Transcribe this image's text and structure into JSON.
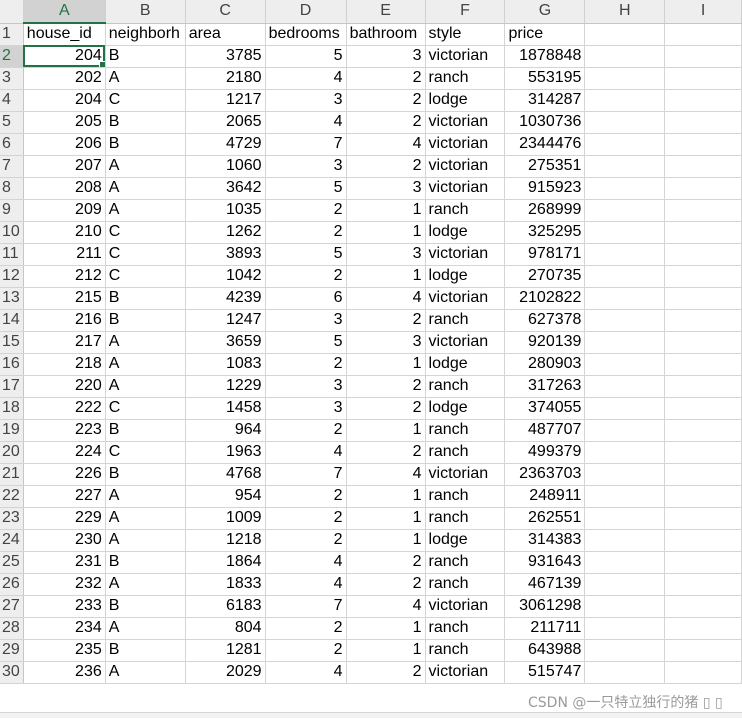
{
  "columns": [
    "A",
    "B",
    "C",
    "D",
    "E",
    "F",
    "G",
    "H",
    "I"
  ],
  "headers": [
    "house_id",
    "neighborh",
    "area",
    "bedrooms",
    "bathroom",
    "style",
    "price",
    "",
    ""
  ],
  "header_row_number": "1",
  "rows": [
    {
      "n": "2",
      "cells": [
        "204",
        "B",
        "3785",
        "5",
        "3",
        "victorian",
        "1878848"
      ]
    },
    {
      "n": "3",
      "cells": [
        "202",
        "A",
        "2180",
        "4",
        "2",
        "ranch",
        "553195"
      ]
    },
    {
      "n": "4",
      "cells": [
        "204",
        "C",
        "1217",
        "3",
        "2",
        "lodge",
        "314287"
      ]
    },
    {
      "n": "5",
      "cells": [
        "205",
        "B",
        "2065",
        "4",
        "2",
        "victorian",
        "1030736"
      ]
    },
    {
      "n": "6",
      "cells": [
        "206",
        "B",
        "4729",
        "7",
        "4",
        "victorian",
        "2344476"
      ]
    },
    {
      "n": "7",
      "cells": [
        "207",
        "A",
        "1060",
        "3",
        "2",
        "victorian",
        "275351"
      ]
    },
    {
      "n": "8",
      "cells": [
        "208",
        "A",
        "3642",
        "5",
        "3",
        "victorian",
        "915923"
      ]
    },
    {
      "n": "9",
      "cells": [
        "209",
        "A",
        "1035",
        "2",
        "1",
        "ranch",
        "268999"
      ]
    },
    {
      "n": "10",
      "cells": [
        "210",
        "C",
        "1262",
        "2",
        "1",
        "lodge",
        "325295"
      ]
    },
    {
      "n": "11",
      "cells": [
        "211",
        "C",
        "3893",
        "5",
        "3",
        "victorian",
        "978171"
      ]
    },
    {
      "n": "12",
      "cells": [
        "212",
        "C",
        "1042",
        "2",
        "1",
        "lodge",
        "270735"
      ]
    },
    {
      "n": "13",
      "cells": [
        "215",
        "B",
        "4239",
        "6",
        "4",
        "victorian",
        "2102822"
      ]
    },
    {
      "n": "14",
      "cells": [
        "216",
        "B",
        "1247",
        "3",
        "2",
        "ranch",
        "627378"
      ]
    },
    {
      "n": "15",
      "cells": [
        "217",
        "A",
        "3659",
        "5",
        "3",
        "victorian",
        "920139"
      ]
    },
    {
      "n": "16",
      "cells": [
        "218",
        "A",
        "1083",
        "2",
        "1",
        "lodge",
        "280903"
      ]
    },
    {
      "n": "17",
      "cells": [
        "220",
        "A",
        "1229",
        "3",
        "2",
        "ranch",
        "317263"
      ]
    },
    {
      "n": "18",
      "cells": [
        "222",
        "C",
        "1458",
        "3",
        "2",
        "lodge",
        "374055"
      ]
    },
    {
      "n": "19",
      "cells": [
        "223",
        "B",
        "964",
        "2",
        "1",
        "ranch",
        "487707"
      ]
    },
    {
      "n": "20",
      "cells": [
        "224",
        "C",
        "1963",
        "4",
        "2",
        "ranch",
        "499379"
      ]
    },
    {
      "n": "21",
      "cells": [
        "226",
        "B",
        "4768",
        "7",
        "4",
        "victorian",
        "2363703"
      ]
    },
    {
      "n": "22",
      "cells": [
        "227",
        "A",
        "954",
        "2",
        "1",
        "ranch",
        "248911"
      ]
    },
    {
      "n": "23",
      "cells": [
        "229",
        "A",
        "1009",
        "2",
        "1",
        "ranch",
        "262551"
      ]
    },
    {
      "n": "24",
      "cells": [
        "230",
        "A",
        "1218",
        "2",
        "1",
        "lodge",
        "314383"
      ]
    },
    {
      "n": "25",
      "cells": [
        "231",
        "B",
        "1864",
        "4",
        "2",
        "ranch",
        "931643"
      ]
    },
    {
      "n": "26",
      "cells": [
        "232",
        "A",
        "1833",
        "4",
        "2",
        "ranch",
        "467139"
      ]
    },
    {
      "n": "27",
      "cells": [
        "233",
        "B",
        "6183",
        "7",
        "4",
        "victorian",
        "3061298"
      ]
    },
    {
      "n": "28",
      "cells": [
        "234",
        "A",
        "804",
        "2",
        "1",
        "ranch",
        "211711"
      ]
    },
    {
      "n": "29",
      "cells": [
        "235",
        "B",
        "1281",
        "2",
        "1",
        "ranch",
        "643988"
      ]
    },
    {
      "n": "30",
      "cells": [
        "236",
        "A",
        "2029",
        "4",
        "2",
        "victorian",
        "515747"
      ]
    }
  ],
  "selected_cell": "A2",
  "accent_color": "#217346",
  "watermark": "CSDN @一只特立独行的猪 ▯ ▯"
}
